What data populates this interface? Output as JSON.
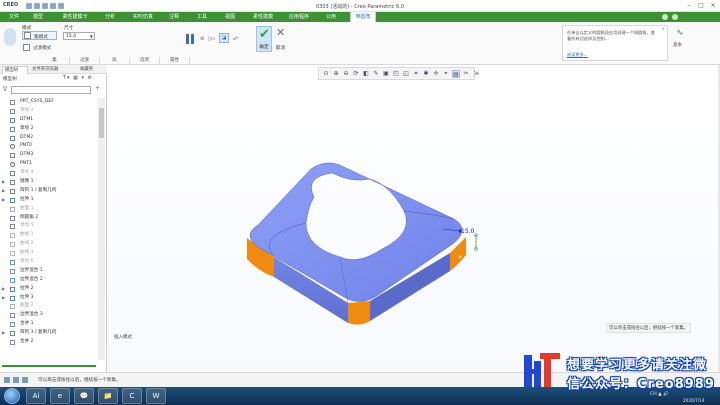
{
  "app": {
    "logo": "CREO",
    "title": "0303 (活动的) - Creo Parametric 6.0"
  },
  "ribbon_tabs": [
    {
      "label": "文件",
      "active": false
    },
    {
      "label": "模型",
      "active": false
    },
    {
      "label": "柔性建模卡",
      "active": false
    },
    {
      "label": "分析",
      "active": false
    },
    {
      "label": "实时仿真",
      "active": false
    },
    {
      "label": "注释",
      "active": false
    },
    {
      "label": "工具",
      "active": false
    },
    {
      "label": "视图",
      "active": false
    },
    {
      "label": "柔性建模",
      "active": false
    },
    {
      "label": "应用程序",
      "active": false
    },
    {
      "label": "公用",
      "active": false
    },
    {
      "label": "倒圆角",
      "active": true
    }
  ],
  "dashboard": {
    "mode_group_label": "模式",
    "size_group_label": "尺寸",
    "mode_options": [
      "集模式",
      "过渡模式"
    ],
    "radius_value": "15.0",
    "ok_label": "确定",
    "cancel_label": "取消",
    "sub_tabs": [
      "集",
      "过渡",
      "段",
      "选项",
      "属性"
    ],
    "help_text": "在单击以定义的圆角段应用创建一个倒圆角，查看所有边选择及控制...",
    "help_more": "阅读更多...",
    "right_label": "基本"
  },
  "panel": {
    "tabs": [
      "模型树",
      "文件夹浏览器",
      "收藏夹"
    ],
    "header": "模型树",
    "items": [
      {
        "label": "PRT_CSYS_DEF",
        "expandable": false,
        "dim": false,
        "icon": "csys-icon"
      },
      {
        "label": "草绘 1",
        "expandable": false,
        "dim": true,
        "icon": "sketch-icon"
      },
      {
        "label": "DTM1",
        "expandable": false,
        "dim": false,
        "icon": "plane-icon"
      },
      {
        "label": "草绘 2",
        "expandable": false,
        "dim": false,
        "icon": "sketch-icon"
      },
      {
        "label": "DTM2",
        "expandable": false,
        "dim": false,
        "icon": "plane-icon"
      },
      {
        "label": "PNT0",
        "expandable": false,
        "dim": false,
        "icon": "point-icon"
      },
      {
        "label": "DTM3",
        "expandable": false,
        "dim": false,
        "icon": "plane-icon"
      },
      {
        "label": "PNT1",
        "expandable": false,
        "dim": false,
        "icon": "point-icon"
      },
      {
        "label": "草绘 4",
        "expandable": false,
        "dim": true,
        "icon": "sketch-icon"
      },
      {
        "label": "镜像 1",
        "expandable": true,
        "dim": false,
        "icon": "mirror-icon"
      },
      {
        "label": "阵列 1 / 复制几何",
        "expandable": true,
        "dim": false,
        "icon": "pattern-icon"
      },
      {
        "label": "拉伸 1",
        "expandable": true,
        "dim": false,
        "icon": "extrude-icon"
      },
      {
        "label": "曲面 1",
        "expandable": false,
        "dim": true,
        "icon": "surface-icon"
      },
      {
        "label": "倒圆角 2",
        "expandable": false,
        "dim": false,
        "icon": "round-icon"
      },
      {
        "label": "草绘 5",
        "expandable": false,
        "dim": true,
        "icon": "sketch-icon"
      },
      {
        "label": "曲线 1",
        "expandable": false,
        "dim": true,
        "icon": "curve-icon"
      },
      {
        "label": "曲线 2",
        "expandable": false,
        "dim": true,
        "icon": "curve-icon"
      },
      {
        "label": "曲线 3",
        "expandable": false,
        "dim": true,
        "icon": "curve-icon"
      },
      {
        "label": "草绘 6",
        "expandable": false,
        "dim": true,
        "icon": "sketch-icon"
      },
      {
        "label": "边界混合 1",
        "expandable": false,
        "dim": false,
        "icon": "blend-icon"
      },
      {
        "label": "边界混合 2",
        "expandable": false,
        "dim": false,
        "icon": "blend-icon"
      },
      {
        "label": "拉伸 2",
        "expandable": true,
        "dim": false,
        "icon": "extrude-icon"
      },
      {
        "label": "拉伸 3",
        "expandable": true,
        "dim": false,
        "icon": "extrude-icon"
      },
      {
        "label": "曲面 2",
        "expandable": false,
        "dim": true,
        "icon": "surface-icon"
      },
      {
        "label": "边界混合 3",
        "expandable": false,
        "dim": false,
        "icon": "blend-icon"
      },
      {
        "label": "合并 1",
        "expandable": false,
        "dim": false,
        "icon": "merge-icon"
      },
      {
        "label": "阵列 3 / 复制几何",
        "expandable": true,
        "dim": false,
        "icon": "pattern-icon"
      },
      {
        "label": "合并 2",
        "expandable": false,
        "dim": false,
        "icon": "merge-icon"
      }
    ]
  },
  "viewport": {
    "dimension_label": "15.0",
    "hint_right": "可以单击或按住以后，继续按一个新集。",
    "bottom_left_label": "插入模式"
  },
  "status": {
    "message": "可以单击或按住以后，继续按一个新集。"
  },
  "taskbar": {
    "apps": [
      "Ai",
      "e",
      "💬",
      "📁",
      "C",
      "W"
    ],
    "tray": "CH ▲ 🔊",
    "datetime": "2020/7/14"
  },
  "watermark": {
    "line1": "想要学习更多请关注微",
    "line2": "信公众号：Creo8989"
  },
  "colors": {
    "ribbon_green": "#3e8f36",
    "accent_blue": "#2a7fd4",
    "model_blue": "#7b8ff0",
    "model_orange": "#f08a10"
  }
}
